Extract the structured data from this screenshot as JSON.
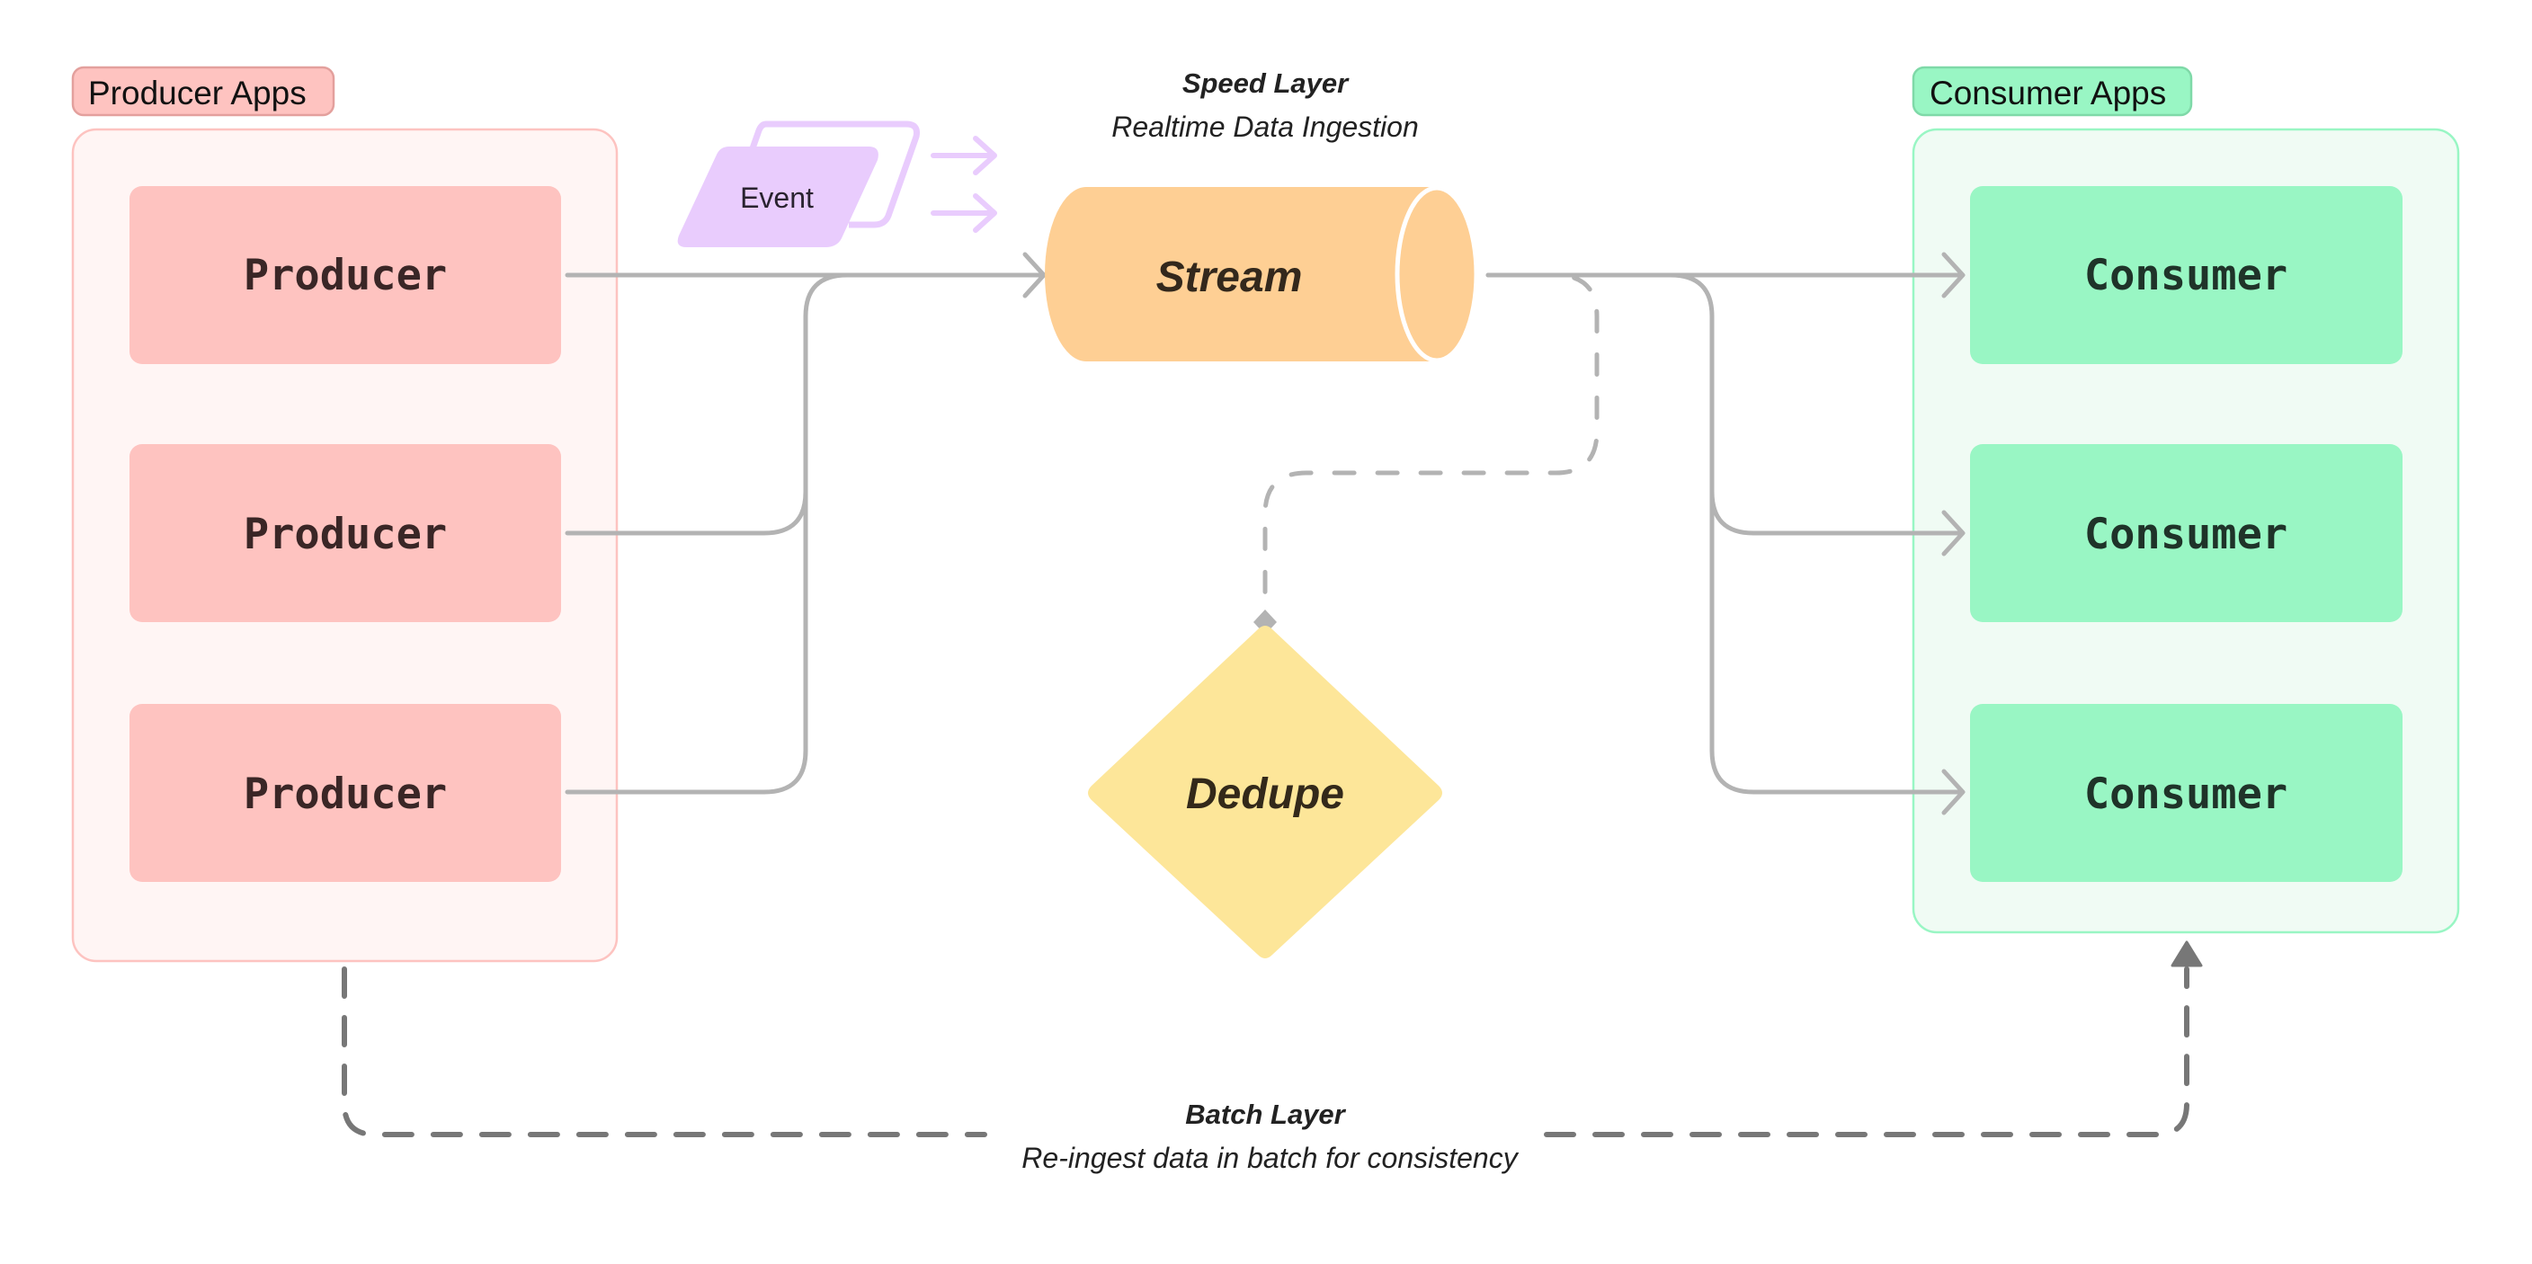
{
  "diagram": {
    "producer_group": {
      "label": "Producer Apps",
      "items": [
        "Producer",
        "Producer",
        "Producer"
      ]
    },
    "consumer_group": {
      "label": "Consumer Apps",
      "items": [
        "Consumer",
        "Consumer",
        "Consumer"
      ]
    },
    "event": {
      "label": "Event"
    },
    "stream": {
      "label": "Stream"
    },
    "dedupe": {
      "label": "Dedupe"
    },
    "speed_layer": {
      "title": "Speed Layer",
      "subtitle": "Realtime Data Ingestion"
    },
    "batch_layer": {
      "title": "Batch Layer",
      "subtitle": "Re-ingest data in batch for consistency"
    },
    "colors": {
      "producer_fill": "#fec3c0",
      "producer_container": "#fff5f4",
      "producer_border": "#fdc3c0",
      "producer_label_border": "#e3a09d",
      "producer_text": "#3a2626",
      "consumer_fill": "#99f6c4",
      "consumer_container": "#f0fbf4",
      "consumer_border": "#99f6c4",
      "consumer_label_border": "#7fd9a8",
      "consumer_text": "#1f3329",
      "event_fill": "#e9ccfd",
      "stream_fill": "#fecf94",
      "dedupe_fill": "#fde699",
      "connector": "#b3b3b3",
      "batch_connector": "#777777"
    }
  }
}
